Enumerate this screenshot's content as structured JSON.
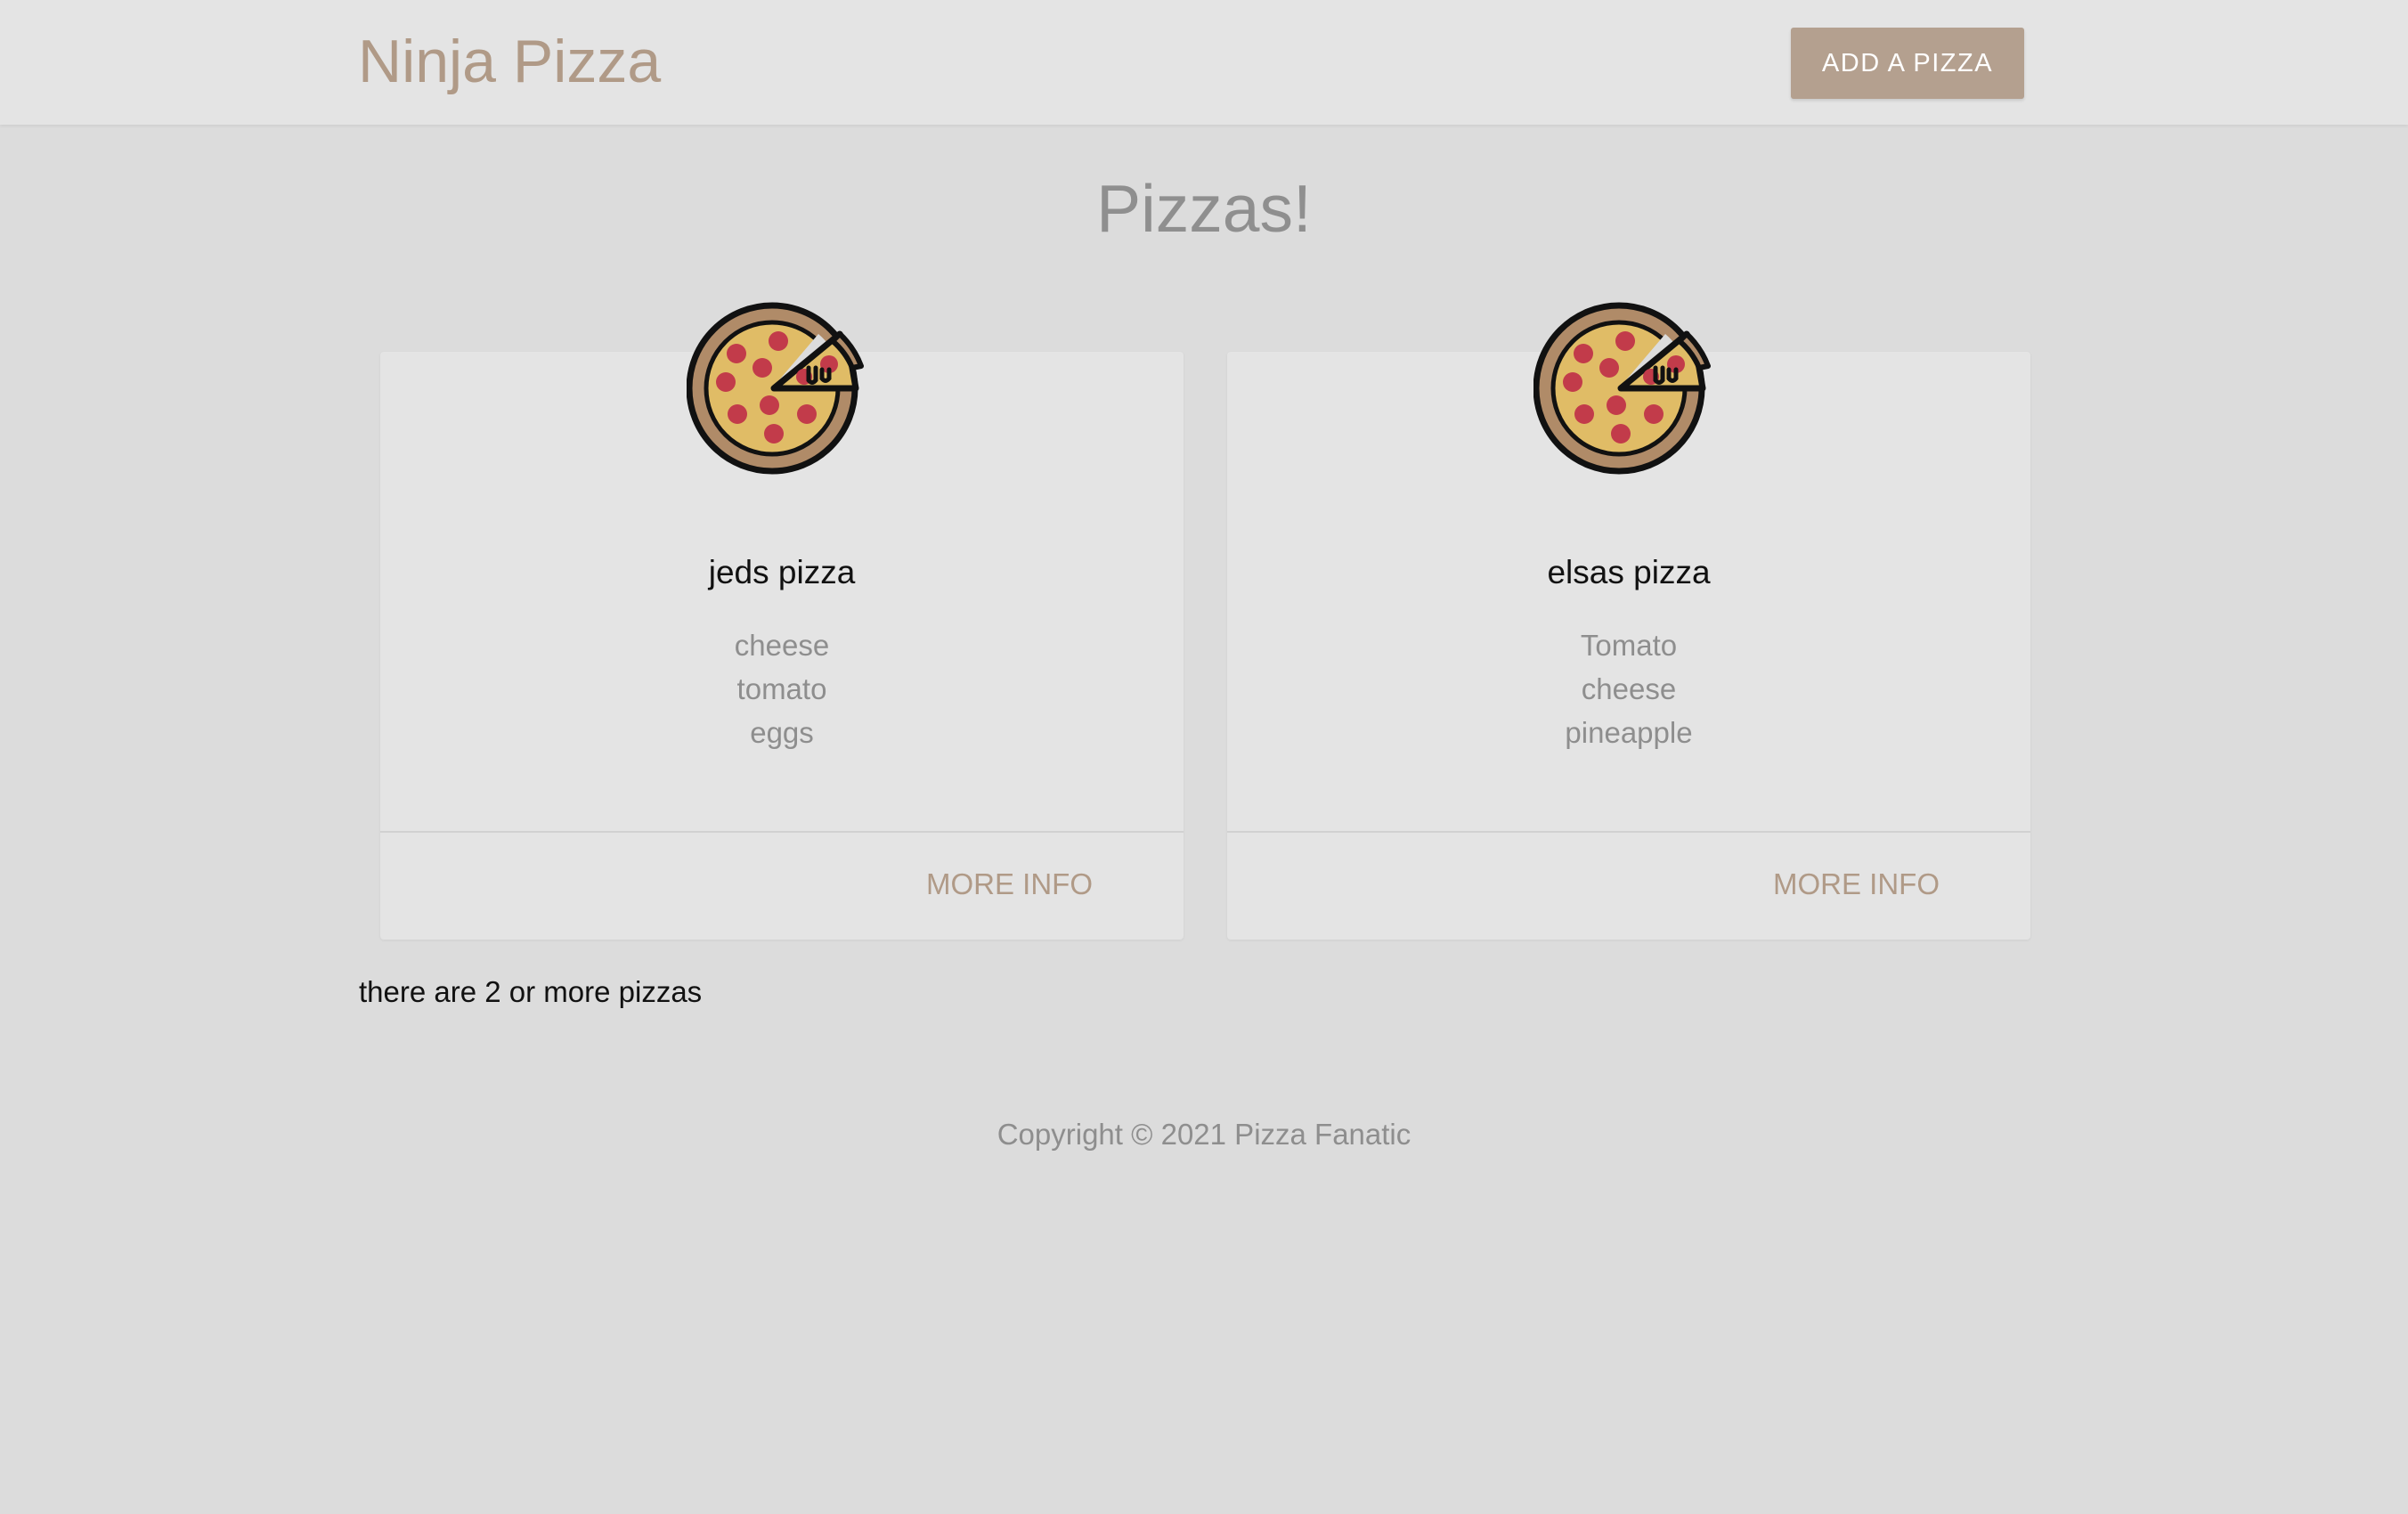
{
  "header": {
    "brand": "Ninja Pizza",
    "add_button_label": "ADD A PIZZA"
  },
  "main": {
    "title": "Pizzas!",
    "pizzas": [
      {
        "name": "jeds pizza",
        "ingredients": [
          "cheese",
          "tomato",
          "eggs"
        ],
        "more_info_label": "MORE INFO",
        "icon": "pizza-icon"
      },
      {
        "name": "elsas pizza",
        "ingredients": [
          "Tomato",
          "cheese",
          "pineapple"
        ],
        "more_info_label": "MORE INFO",
        "icon": "pizza-icon"
      }
    ],
    "count_message": "there are 2 or more pizzas"
  },
  "footer": {
    "copyright": "Copyright © 2021 Pizza Fanatic"
  },
  "colors": {
    "brand": "#b09a87",
    "button": "#b4a08f",
    "background": "#dcdcdc",
    "card": "#e4e4e4"
  }
}
